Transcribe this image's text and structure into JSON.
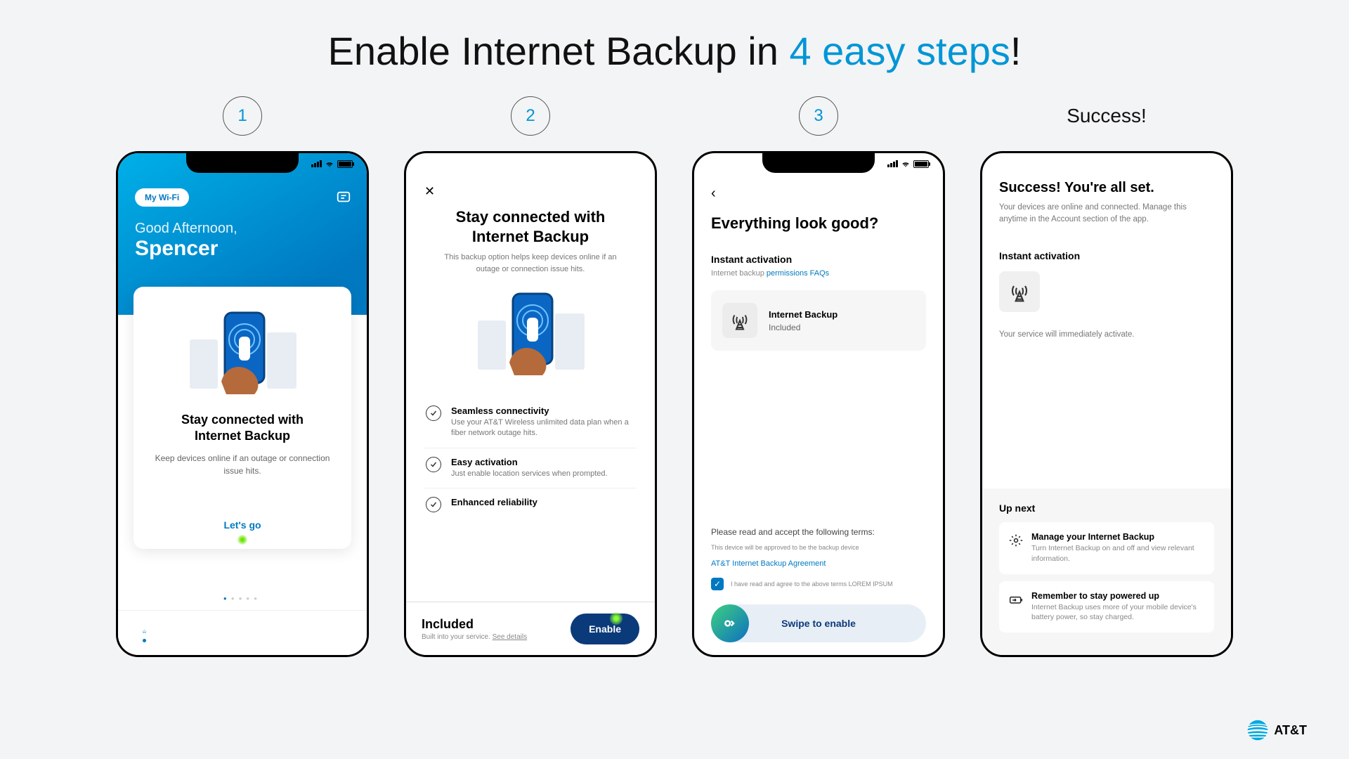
{
  "title_prefix": "Enable Internet Backup in ",
  "title_highlight": "4 easy steps",
  "title_suffix": "!",
  "steps": {
    "s1": "1",
    "s2": "2",
    "s3": "3",
    "success": "Success!"
  },
  "phone1": {
    "pill": "My Wi-Fi",
    "greeting": "Good Afternoon,",
    "name": "Spencer",
    "card_title_l1": "Stay connected with",
    "card_title_l2": "Internet Backup",
    "card_desc": "Keep devices online if an outage or connection issue hits.",
    "cta": "Let's go"
  },
  "phone2": {
    "title_l1": "Stay connected with",
    "title_l2": "Internet Backup",
    "sub": "This backup option helps keep devices online if an outage or connection issue hits.",
    "feat1_t": "Seamless connectivity",
    "feat1_d": "Use your AT&T Wireless unlimited data plan when a fiber network outage hits.",
    "feat2_t": "Easy activation",
    "feat2_d": "Just enable location services when prompted.",
    "feat3_t": "Enhanced reliability",
    "included": "Included",
    "built": "Built into your service. ",
    "see": "See details",
    "enable": "Enable"
  },
  "phone3": {
    "title": "Everything look good?",
    "section": "Instant activation",
    "faq_pre": "Internet backup ",
    "faq_link": "permissions FAQs",
    "card_t": "Internet Backup",
    "card_s": "Included",
    "terms_lead": "Please read and accept the following terms:",
    "terms_tiny": "This device will be approved to be the backup device",
    "agreement": "AT&T Internet Backup Agreement",
    "agree": "I have read and agree to the above terms LOREM IPSUM",
    "swipe": "Swipe to enable"
  },
  "phone4": {
    "title": "Success! You're all set.",
    "lead": "Your devices are online and connected. Manage this anytime in the Account section of the app.",
    "section": "Instant activation",
    "note": "Your service will immediately activate.",
    "upnext": "Up next",
    "c1_t": "Manage your Internet Backup",
    "c1_d": "Turn Internet Backup on and off and view relevant information.",
    "c2_t": "Remember to stay powered up",
    "c2_d": "Internet Backup uses more of your mobile device's battery power, so stay charged."
  },
  "brand": "AT&T"
}
